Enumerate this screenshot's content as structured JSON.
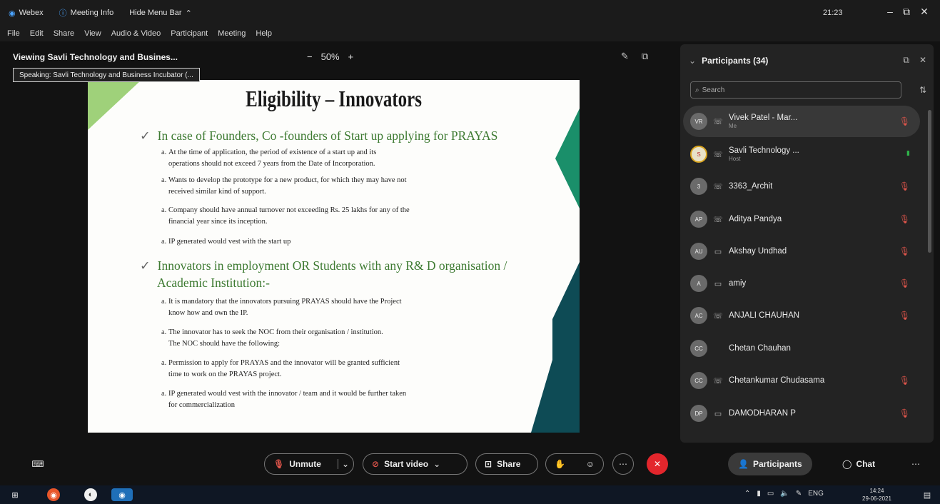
{
  "titlebar": {
    "app_name": "Webex",
    "meeting_info": "Meeting Info",
    "hide_menu_bar": "Hide Menu Bar",
    "clock": "21:23"
  },
  "menu": [
    "File",
    "Edit",
    "Share",
    "View",
    "Audio & Video",
    "Participant",
    "Meeting",
    "Help"
  ],
  "share": {
    "viewing": "Viewing Savli Technology and Busines...",
    "zoom_minus": "−",
    "zoom_level": "50%",
    "zoom_plus": "+",
    "speaking": "Speaking: Savli Technology and Business Incubator (..."
  },
  "slide": {
    "title": "Eligibility – Innovators",
    "bullet1": "In case of Founders, Co -founders of Start up applying for PRAYAS",
    "items1": [
      [
        "At the time of application, the period of existence of a start up and its",
        "operations should not exceed 7 years from the Date of Incorporation."
      ],
      [
        "Wants to develop the prototype for a new product, for which they may have not",
        "received similar kind of support."
      ],
      [
        "Company should have annual turnover not exceeding Rs. 25 lakhs for any of the",
        "financial year since its inception."
      ],
      [
        "IP generated would vest with the start up",
        ""
      ]
    ],
    "bullet2a": "Innovators in employment OR Students with any R& D organisation /",
    "bullet2b": "Academic Institution:-",
    "items2": [
      [
        "It is mandatory that the innovators pursuing PRAYAS should have the Project",
        "know how and own the IP."
      ],
      [
        "The innovator has to seek the NOC from their organisation / institution.",
        "The NOC should have the following:"
      ],
      [
        "Permission to apply for PRAYAS and the innovator will be granted sufficient",
        "time to work on the PRAYAS project."
      ],
      [
        "IP generated would vest with the innovator / team and it would be further taken",
        "for commercialization"
      ]
    ]
  },
  "participants": {
    "header": "Participants (34)",
    "search_placeholder": "Search",
    "list": [
      {
        "initials": "VR",
        "name": "Vivek Patel - Mar...",
        "role": "Me",
        "device": "phone",
        "mic": "muted"
      },
      {
        "initials": "S",
        "name": "Savli Technology ...",
        "role": "Host",
        "device": "phone",
        "mic": "on"
      },
      {
        "initials": "3",
        "name": "3363_Archit",
        "role": "",
        "device": "phone",
        "mic": "muted"
      },
      {
        "initials": "AP",
        "name": "Aditya Pandya",
        "role": "",
        "device": "phone",
        "mic": "muted"
      },
      {
        "initials": "AU",
        "name": "Akshay Undhad",
        "role": "",
        "device": "desktop",
        "mic": "muted"
      },
      {
        "initials": "A",
        "name": "amiy",
        "role": "",
        "device": "desktop",
        "mic": "muted"
      },
      {
        "initials": "AC",
        "name": "ANJALI CHAUHAN",
        "role": "",
        "device": "phone",
        "mic": "muted"
      },
      {
        "initials": "CC",
        "name": "Chetan Chauhan",
        "role": "",
        "device": "none",
        "mic": "none"
      },
      {
        "initials": "CC",
        "name": "Chetankumar Chudasama",
        "role": "",
        "device": "phone",
        "mic": "muted"
      },
      {
        "initials": "DP",
        "name": "DAMODHARAN P",
        "role": "",
        "device": "desktop",
        "mic": "muted"
      }
    ]
  },
  "toolbar": {
    "unmute": "Unmute",
    "start_video": "Start video",
    "share": "Share",
    "participants": "Participants",
    "chat": "Chat"
  },
  "taskbar": {
    "lang": "ENG",
    "time": "14:24",
    "date": "29-06-2021"
  },
  "colors": {
    "muted_mic": "#e0554b",
    "leave": "#e3262c",
    "slide_green": "#3d7a31",
    "slide_teal": "#0e4b55"
  }
}
